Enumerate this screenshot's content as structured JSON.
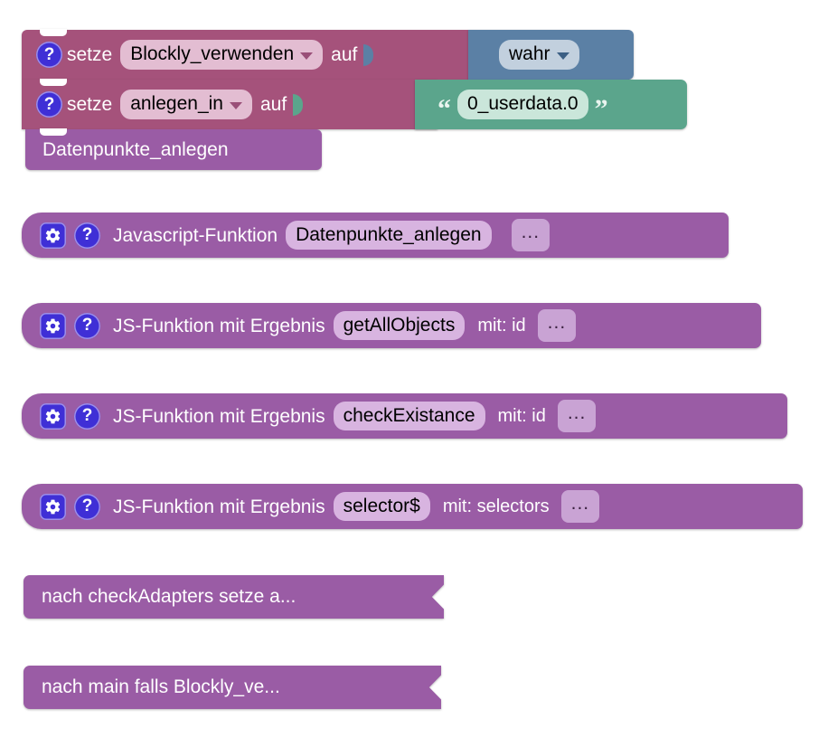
{
  "workspace": {
    "name": "Blockly Workspace",
    "background_color": "#ffffff",
    "grid_color": "#c8c8c8",
    "grid_spacing": 50
  },
  "palette": {
    "variable_block": "#a5527b",
    "variable_field": "#e3bdd2",
    "logic_block": "#5b80a5",
    "logic_field": "#c2d0de",
    "text_block": "#5ba58c",
    "text_field": "#cae6da",
    "function_block": "#9a5ca5",
    "function_field": "#d8b4e0",
    "icon_blue": "#3f2fd6"
  },
  "blocks": [
    {
      "id": "set-blockly-verwenden",
      "type": "variables_set",
      "kind": "statement",
      "help_icon": "question-icon",
      "keyword": "setze",
      "variable": "Blockly_verwenden",
      "dropdown_icon": "chevron-down-icon",
      "connector": "auf",
      "value": {
        "type": "logic_boolean",
        "kind": "value",
        "field": "wahr",
        "dropdown_icon": "chevron-down-icon"
      }
    },
    {
      "id": "set-anlegen-in",
      "type": "variables_set",
      "kind": "statement",
      "help_icon": "question-icon",
      "keyword": "setze",
      "variable": "anlegen_in",
      "dropdown_icon": "chevron-down-icon",
      "connector": "auf",
      "value": {
        "type": "text",
        "kind": "value",
        "quote_open": "“",
        "quote_close": "”",
        "field": "0_userdata.0"
      }
    },
    {
      "id": "call-datenpunkte-anlegen",
      "type": "procedures_callnoreturn",
      "kind": "statement",
      "label": "Datenpunkte_anlegen"
    },
    {
      "id": "def-datenpunkte-anlegen",
      "type": "procedures_defnoreturn_js",
      "kind": "hat",
      "gear_icon": "gear-icon",
      "help_icon": "question-icon",
      "title": "Javascript-Funktion",
      "name": "Datenpunkte_anlegen",
      "params_label": "..."
    },
    {
      "id": "def-getallobjects",
      "type": "procedures_defreturn_js",
      "kind": "hat",
      "gear_icon": "gear-icon",
      "help_icon": "question-icon",
      "title": "JS-Funktion mit Ergebnis",
      "name": "getAllObjects",
      "args_label": "mit: id",
      "params_label": "..."
    },
    {
      "id": "def-checkexistance",
      "type": "procedures_defreturn_js",
      "kind": "hat",
      "gear_icon": "gear-icon",
      "help_icon": "question-icon",
      "title": "JS-Funktion mit Ergebnis",
      "name": "checkExistance",
      "args_label": "mit: id",
      "params_label": "..."
    },
    {
      "id": "def-selector",
      "type": "procedures_defreturn_js",
      "kind": "hat",
      "gear_icon": "gear-icon",
      "help_icon": "question-icon",
      "title": "JS-Funktion mit Ergebnis",
      "name": "selector$",
      "args_label": "mit: selectors",
      "params_label": "..."
    },
    {
      "id": "collapsed-checkadapters",
      "type": "procedures_collapsed",
      "kind": "collapsed",
      "label": "nach checkAdapters  setze a..."
    },
    {
      "id": "collapsed-main",
      "type": "procedures_collapsed",
      "kind": "collapsed",
      "label": "nach main  falls Blockly_ve..."
    }
  ]
}
